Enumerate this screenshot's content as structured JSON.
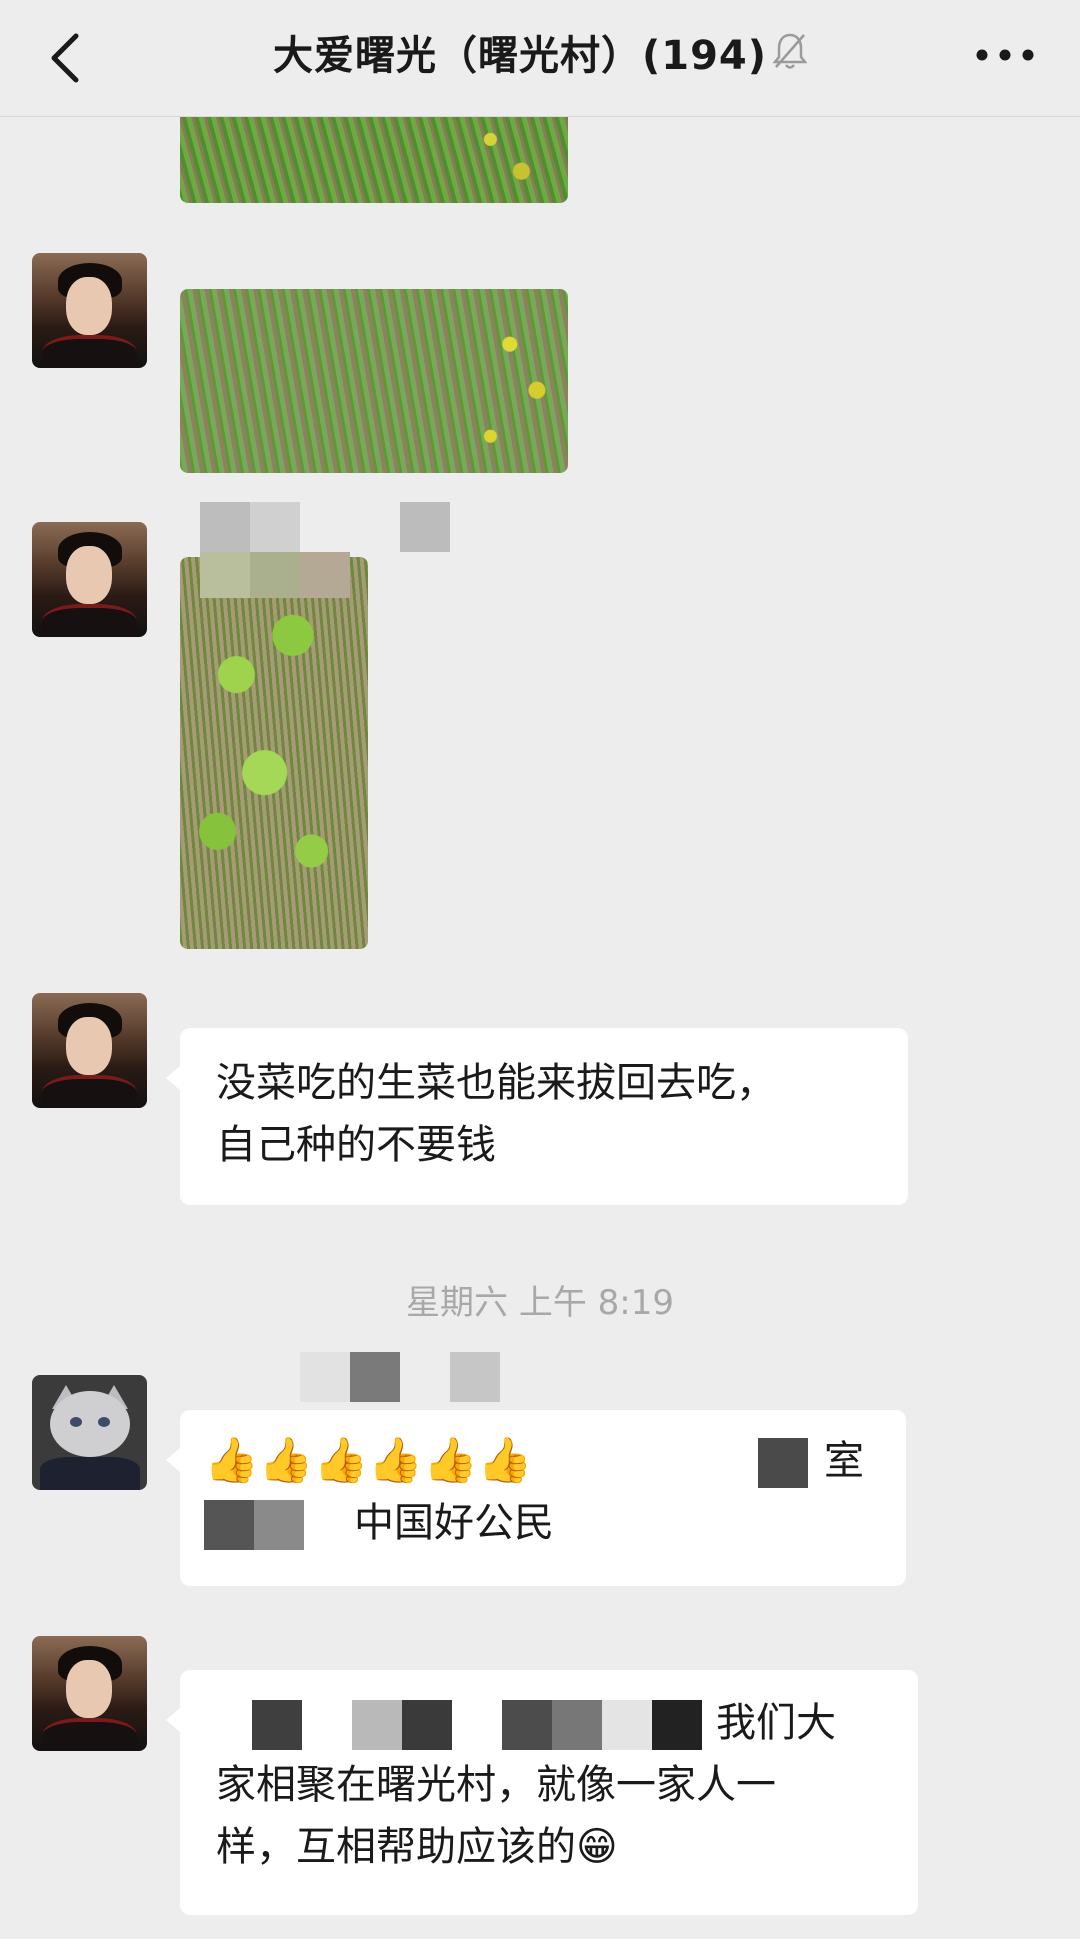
{
  "header": {
    "title": "大爱曙光（曙光村）(194)",
    "back_icon": "chevron-left-icon",
    "mute_icon": "bell-muted-icon",
    "more_icon": "more-dots-icon"
  },
  "messages": [
    {
      "type": "image",
      "sender": "woman-avatar",
      "content": "grass-field-photo"
    },
    {
      "type": "image",
      "sender": "woman-avatar",
      "content": "grass-field-photo"
    },
    {
      "type": "image",
      "sender": "woman-avatar",
      "content": "lettuce-field-photo"
    },
    {
      "type": "text",
      "sender": "woman-avatar",
      "lines": [
        "没菜吃的生菜也能来拔回去吃，",
        "自己种的不要钱"
      ]
    },
    {
      "type": "text",
      "sender": "cat-avatar",
      "line1_tail": "室",
      "line2": "中国好公民"
    },
    {
      "type": "text",
      "sender": "woman-avatar",
      "line1_tail": "我们大",
      "lines": [
        "家相聚在曙光村，就像一家人一",
        "样，互相帮助应该的"
      ]
    }
  ],
  "timestamp": "星期六 上午 8:19",
  "colors": {
    "background": "#ededed",
    "bubble": "#ffffff",
    "timestamp": "#a8a8a8"
  }
}
